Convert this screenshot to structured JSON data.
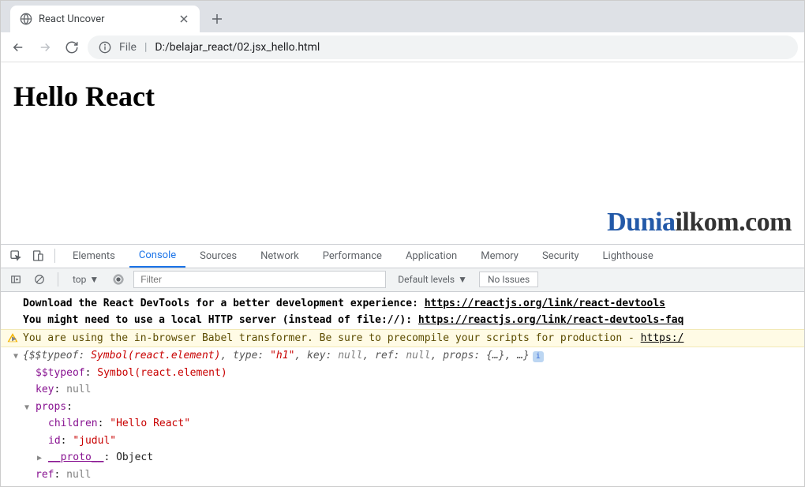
{
  "tab": {
    "title": "React Uncover"
  },
  "addr": {
    "prefix": "File",
    "path": "D:/belajar_react/02.jsx_hello.html"
  },
  "page": {
    "heading": "Hello React"
  },
  "watermark": {
    "a": "Dunia",
    "b": "ilkom.com"
  },
  "devtools": {
    "tabs": [
      "Elements",
      "Console",
      "Sources",
      "Network",
      "Performance",
      "Application",
      "Memory",
      "Security",
      "Lighthouse"
    ],
    "activeTab": "Console",
    "ctx": "top",
    "filterPlaceholder": "Filter",
    "levels": "Default levels",
    "issues": "No Issues"
  },
  "console": {
    "l1a": "Download the React DevTools for a better development experience: ",
    "l1b": "https://reactjs.org/link/react-devtools",
    "l2a": "You might need to use a local HTTP server (instead of file://): ",
    "l2b": "https://reactjs.org/link/react-devtools-faq",
    "w": "You are using the in-browser Babel transformer. Be sure to precompile your scripts for production - ",
    "wlink": "https:/",
    "obj_head_a": "{$$typeof: ",
    "obj_head_sym": "Symbol(react.element)",
    "obj_head_b": ", type: ",
    "obj_head_type": "\"h1\"",
    "obj_head_c": ", key: ",
    "obj_head_null": "null",
    "obj_head_d": ", ref: ",
    "obj_head_e": ", props: ",
    "obj_head_props": "{…}",
    "obj_head_f": ", …}",
    "f_typeof_k": "$$typeof",
    "f_typeof_v": "Symbol(react.element)",
    "f_key_k": "key",
    "f_key_v": "null",
    "f_props_k": "props",
    "f_children_k": "children",
    "f_children_v": "\"Hello React\"",
    "f_id_k": "id",
    "f_id_v": "\"judul\"",
    "f_proto_k": "__proto__",
    "f_proto_v": "Object",
    "f_ref_k": "ref",
    "f_ref_v": "null"
  }
}
